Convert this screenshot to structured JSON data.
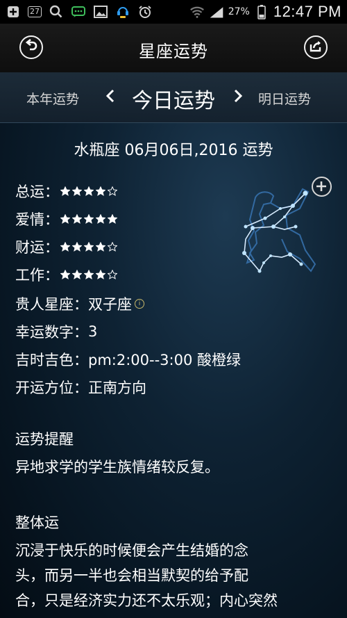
{
  "status_bar": {
    "notification_count": "27",
    "battery": "27%",
    "time": "12:47 PM"
  },
  "header": {
    "title": "星座运势"
  },
  "day_nav": {
    "prev_label": "本年运势",
    "current_label": "今日运势",
    "next_label": "明日运势"
  },
  "fortune": {
    "heading": "水瓶座 06月06日,2016 运势",
    "ratings": [
      {
        "label": "总运：",
        "stars": 4,
        "max": 5
      },
      {
        "label": "爱情：",
        "stars": 5,
        "max": 5
      },
      {
        "label": "财运：",
        "stars": 4,
        "max": 5
      },
      {
        "label": "工作：",
        "stars": 4,
        "max": 5
      }
    ],
    "noble_sign_label": "贵人星座：",
    "noble_sign_value": "双子座",
    "lucky_number_label": "幸运数字：",
    "lucky_number_value": "3",
    "lucky_time_label": "吉时吉色：",
    "lucky_time_value": "pm:2:00--3:00 酸橙绿",
    "direction_label": "开运方位：",
    "direction_value": "正南方向",
    "reminder_title": "运势提醒",
    "reminder_text": "异地求学的学生族情绪较反复。",
    "overall_title": "整体运",
    "overall_lines": [
      "沉浸于快乐的时候便会产生结婚的念",
      "头，而另一半也会相当默契的给予配",
      "合，只是经济实力还不太乐观；内心突然"
    ]
  },
  "colors": {
    "star_fill": "#ffffff",
    "info_icon": "#c8b86a",
    "constellation": "#7fc8ff"
  }
}
